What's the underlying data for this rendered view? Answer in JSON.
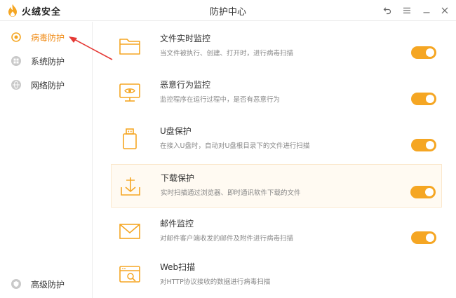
{
  "app": {
    "logo_text": "火绒安全",
    "window_title": "防护中心"
  },
  "sidebar": {
    "items": [
      {
        "label": "病毒防护",
        "icon": "target-icon",
        "active": true
      },
      {
        "label": "系统防护",
        "icon": "windows-icon",
        "active": false
      },
      {
        "label": "网络防护",
        "icon": "globe-icon",
        "active": false
      }
    ],
    "bottom_item": {
      "label": "高级防护",
      "icon": "shield-icon"
    }
  },
  "protections": [
    {
      "title": "文件实时监控",
      "desc": "当文件被执行、创建、打开时，进行病毒扫描",
      "icon": "folder-icon",
      "enabled": true
    },
    {
      "title": "恶意行为监控",
      "desc": "监控程序在运行过程中，是否有恶意行为",
      "icon": "monitor-eye-icon",
      "enabled": true
    },
    {
      "title": "U盘保护",
      "desc": "在接入U盘时，自动对U盘根目录下的文件进行扫描",
      "icon": "usb-drive-icon",
      "enabled": true
    },
    {
      "title": "下载保护",
      "desc": "实时扫描通过浏览器、即时通讯软件下载的文件",
      "icon": "download-tray-icon",
      "enabled": true
    },
    {
      "title": "邮件监控",
      "desc": "对邮件客户端收发的邮件及附件进行病毒扫描",
      "icon": "mail-icon",
      "enabled": true
    },
    {
      "title": "Web扫描",
      "desc": "对HTTP协议接收的数据进行病毒扫描",
      "icon": "web-scan-icon",
      "enabled": true
    }
  ],
  "colors": {
    "accent": "#f5a623",
    "active_text": "#f08c18",
    "highlight_bg": "#fffaf2",
    "arrow": "#e53935"
  }
}
